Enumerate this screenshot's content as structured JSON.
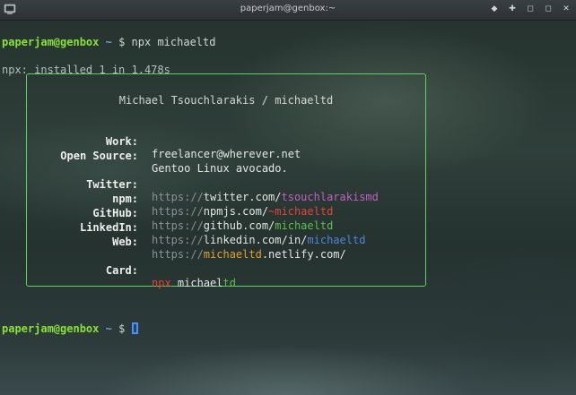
{
  "window": {
    "title": "paperjam@genbox:~",
    "buttons": [
      "◆",
      "✚",
      "◻",
      "◻",
      "✕"
    ],
    "button_names": [
      "sticky-button",
      "maximize-vert-button",
      "minimize-button",
      "maximize-button",
      "close-button"
    ]
  },
  "terminal": {
    "prompt_user": "paperjam@genbox",
    "prompt_path": "~",
    "prompt_sign": "$",
    "command": "npx michaeltd",
    "output": "npx: installed 1 in 1.478s"
  },
  "card": {
    "name": "Michael Tsouchlarakis",
    "separator": "/",
    "handle": "michaeltd",
    "work_label": "Work:",
    "work_value": "freelancer@wherever.net",
    "opensource_label": "Open Source:",
    "opensource_value": "Gentoo Linux avocado.",
    "twitter_label": "Twitter:",
    "twitter_prefix": "https://",
    "twitter_domain": "twitter.com/",
    "twitter_user": "tsouchlarakismd",
    "npm_label": "npm:",
    "npm_prefix": "https://",
    "npm_domain": "npmjs.com/",
    "npm_tilde": "~",
    "npm_user": "michaeltd",
    "github_label": "GitHub:",
    "github_prefix": "https://",
    "github_domain": "github.com/",
    "github_user": "michaeltd",
    "linkedin_label": "LinkedIn:",
    "linkedin_prefix": "https://",
    "linkedin_domain": "linkedin.com/in/",
    "linkedin_user": "michaeltd",
    "web_label": "Web:",
    "web_prefix": "https://",
    "web_user": "michaeltd",
    "web_domain": ".netlify.com/",
    "card_label": "Card:",
    "card_npx": "npx",
    "card_name_a": "michael",
    "card_name_b": "td"
  },
  "prompt2": {
    "user": "paperjam@genbox",
    "path": "~",
    "sign": "$"
  },
  "colors": {
    "prompt_user": "#8ae234",
    "prompt_path": "#729fcf",
    "card_border": "#5fd35f",
    "twitter": "#c060c0",
    "npm": "#e0453a",
    "github": "#5dbf4f",
    "linkedin": "#4f86d6",
    "web": "#e0a030",
    "cursor": "#4a90ff"
  }
}
